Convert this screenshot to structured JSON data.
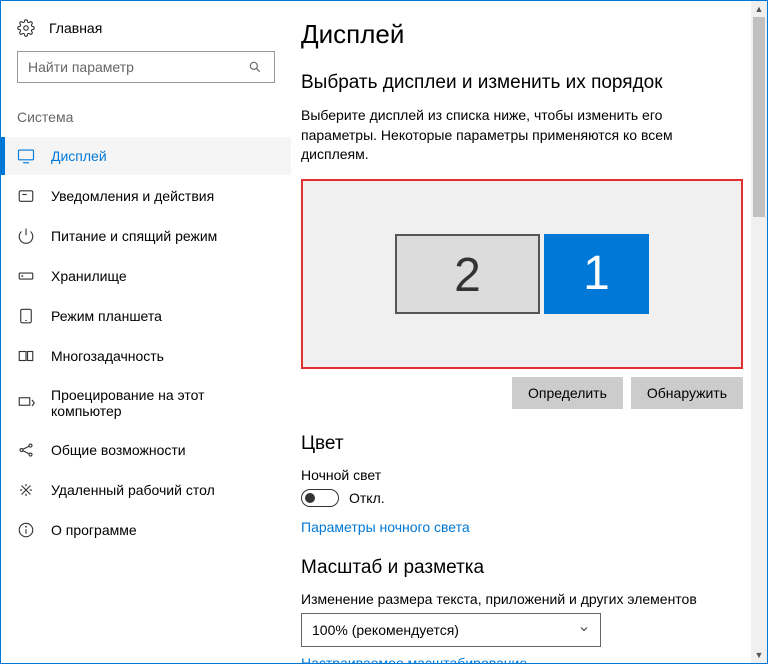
{
  "sidebar": {
    "home_label": "Главная",
    "search_placeholder": "Найти параметр",
    "section_label": "Система",
    "items": [
      {
        "label": "Дисплей"
      },
      {
        "label": "Уведомления и действия"
      },
      {
        "label": "Питание и спящий режим"
      },
      {
        "label": "Хранилище"
      },
      {
        "label": "Режим планшета"
      },
      {
        "label": "Многозадачность"
      },
      {
        "label": "Проецирование на этот компьютер"
      },
      {
        "label": "Общие возможности"
      },
      {
        "label": "Удаленный рабочий стол"
      },
      {
        "label": "О программе"
      }
    ]
  },
  "main": {
    "title": "Дисплей",
    "section1_title": "Выбрать дисплеи и изменить их порядок",
    "section1_desc": "Выберите дисплей из списка ниже, чтобы изменить его параметры. Некоторые параметры применяются ко всем дисплеям.",
    "monitors": {
      "left": "2",
      "right": "1"
    },
    "btn_identify": "Определить",
    "btn_detect": "Обнаружить",
    "color_title": "Цвет",
    "night_light_label": "Ночной свет",
    "toggle_state_label": "Откл.",
    "night_light_link": "Параметры ночного света",
    "scale_title": "Масштаб и разметка",
    "scale_desc": "Изменение размера текста, приложений и других элементов",
    "scale_value": "100% (рекомендуется)",
    "custom_scaling_link": "Настраиваемое масштабирование"
  }
}
